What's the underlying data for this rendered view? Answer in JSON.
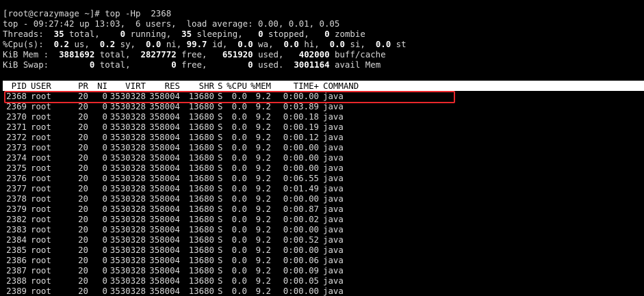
{
  "prompt": {
    "text": "[root@crazymage ~]# top -Hp  2368"
  },
  "summary": {
    "uptime_line": "top - 09:27:42 up 13:03,  6 users,  load average: 0.00, 0.01, 0.05",
    "threads": {
      "label": "Threads:",
      "total": "35",
      "total_label": "total,",
      "running": "0",
      "running_label": "running,",
      "sleeping": "35",
      "sleeping_label": "sleeping,",
      "stopped": "0",
      "stopped_label": "stopped,",
      "zombie": "0",
      "zombie_label": "zombie"
    },
    "cpu": {
      "label": "%Cpu(s):",
      "us": "0.2",
      "us_label": "us,",
      "sy": "0.2",
      "sy_label": "sy,",
      "ni": "0.0",
      "ni_label": "ni,",
      "id": "99.7",
      "id_label": "id,",
      "wa": "0.0",
      "wa_label": "wa,",
      "hi": "0.0",
      "hi_label": "hi,",
      "si": "0.0",
      "si_label": "si,",
      "st": "0.0",
      "st_label": "st"
    },
    "mem": {
      "label": "KiB Mem :",
      "total": "3881692",
      "total_label": "total,",
      "free": "2827772",
      "free_label": "free,",
      "used": "651920",
      "used_label": "used,",
      "buff": "402000",
      "buff_label": "buff/cache"
    },
    "swap": {
      "label": "KiB Swap:",
      "total": "0",
      "total_label": "total,",
      "free": "0",
      "free_label": "free,",
      "used": "0",
      "used_label": "used.",
      "avail": "3001164",
      "avail_label": "avail Mem"
    }
  },
  "table": {
    "headers": {
      "pid": "PID",
      "user": "USER",
      "pr": "PR",
      "ni": "NI",
      "virt": "VIRT",
      "res": "RES",
      "shr": "SHR",
      "s": "S",
      "cpu": "%CPU",
      "mem": "%MEM",
      "time": "TIME+",
      "command": "COMMAND"
    },
    "rows": [
      {
        "pid": "2368",
        "user": "root",
        "pr": "20",
        "ni": "0",
        "virt": "3530328",
        "res": "358004",
        "shr": "13680",
        "s": "S",
        "cpu": "0.0",
        "mem": "9.2",
        "time": "0:00.00",
        "command": "java"
      },
      {
        "pid": "2369",
        "user": "root",
        "pr": "20",
        "ni": "0",
        "virt": "3530328",
        "res": "358004",
        "shr": "13680",
        "s": "S",
        "cpu": "0.0",
        "mem": "9.2",
        "time": "0:03.89",
        "command": "java"
      },
      {
        "pid": "2370",
        "user": "root",
        "pr": "20",
        "ni": "0",
        "virt": "3530328",
        "res": "358004",
        "shr": "13680",
        "s": "S",
        "cpu": "0.0",
        "mem": "9.2",
        "time": "0:00.18",
        "command": "java"
      },
      {
        "pid": "2371",
        "user": "root",
        "pr": "20",
        "ni": "0",
        "virt": "3530328",
        "res": "358004",
        "shr": "13680",
        "s": "S",
        "cpu": "0.0",
        "mem": "9.2",
        "time": "0:00.19",
        "command": "java"
      },
      {
        "pid": "2372",
        "user": "root",
        "pr": "20",
        "ni": "0",
        "virt": "3530328",
        "res": "358004",
        "shr": "13680",
        "s": "S",
        "cpu": "0.0",
        "mem": "9.2",
        "time": "0:00.12",
        "command": "java"
      },
      {
        "pid": "2373",
        "user": "root",
        "pr": "20",
        "ni": "0",
        "virt": "3530328",
        "res": "358004",
        "shr": "13680",
        "s": "S",
        "cpu": "0.0",
        "mem": "9.2",
        "time": "0:00.00",
        "command": "java"
      },
      {
        "pid": "2374",
        "user": "root",
        "pr": "20",
        "ni": "0",
        "virt": "3530328",
        "res": "358004",
        "shr": "13680",
        "s": "S",
        "cpu": "0.0",
        "mem": "9.2",
        "time": "0:00.00",
        "command": "java"
      },
      {
        "pid": "2375",
        "user": "root",
        "pr": "20",
        "ni": "0",
        "virt": "3530328",
        "res": "358004",
        "shr": "13680",
        "s": "S",
        "cpu": "0.0",
        "mem": "9.2",
        "time": "0:00.00",
        "command": "java"
      },
      {
        "pid": "2376",
        "user": "root",
        "pr": "20",
        "ni": "0",
        "virt": "3530328",
        "res": "358004",
        "shr": "13680",
        "s": "S",
        "cpu": "0.0",
        "mem": "9.2",
        "time": "0:06.55",
        "command": "java"
      },
      {
        "pid": "2377",
        "user": "root",
        "pr": "20",
        "ni": "0",
        "virt": "3530328",
        "res": "358004",
        "shr": "13680",
        "s": "S",
        "cpu": "0.0",
        "mem": "9.2",
        "time": "0:01.49",
        "command": "java"
      },
      {
        "pid": "2378",
        "user": "root",
        "pr": "20",
        "ni": "0",
        "virt": "3530328",
        "res": "358004",
        "shr": "13680",
        "s": "S",
        "cpu": "0.0",
        "mem": "9.2",
        "time": "0:00.00",
        "command": "java"
      },
      {
        "pid": "2379",
        "user": "root",
        "pr": "20",
        "ni": "0",
        "virt": "3530328",
        "res": "358004",
        "shr": "13680",
        "s": "S",
        "cpu": "0.0",
        "mem": "9.2",
        "time": "0:00.87",
        "command": "java"
      },
      {
        "pid": "2382",
        "user": "root",
        "pr": "20",
        "ni": "0",
        "virt": "3530328",
        "res": "358004",
        "shr": "13680",
        "s": "S",
        "cpu": "0.0",
        "mem": "9.2",
        "time": "0:00.02",
        "command": "java"
      },
      {
        "pid": "2383",
        "user": "root",
        "pr": "20",
        "ni": "0",
        "virt": "3530328",
        "res": "358004",
        "shr": "13680",
        "s": "S",
        "cpu": "0.0",
        "mem": "9.2",
        "time": "0:00.00",
        "command": "java"
      },
      {
        "pid": "2384",
        "user": "root",
        "pr": "20",
        "ni": "0",
        "virt": "3530328",
        "res": "358004",
        "shr": "13680",
        "s": "S",
        "cpu": "0.0",
        "mem": "9.2",
        "time": "0:00.52",
        "command": "java"
      },
      {
        "pid": "2385",
        "user": "root",
        "pr": "20",
        "ni": "0",
        "virt": "3530328",
        "res": "358004",
        "shr": "13680",
        "s": "S",
        "cpu": "0.0",
        "mem": "9.2",
        "time": "0:00.00",
        "command": "java"
      },
      {
        "pid": "2386",
        "user": "root",
        "pr": "20",
        "ni": "0",
        "virt": "3530328",
        "res": "358004",
        "shr": "13680",
        "s": "S",
        "cpu": "0.0",
        "mem": "9.2",
        "time": "0:00.06",
        "command": "java"
      },
      {
        "pid": "2387",
        "user": "root",
        "pr": "20",
        "ni": "0",
        "virt": "3530328",
        "res": "358004",
        "shr": "13680",
        "s": "S",
        "cpu": "0.0",
        "mem": "9.2",
        "time": "0:00.09",
        "command": "java"
      },
      {
        "pid": "2388",
        "user": "root",
        "pr": "20",
        "ni": "0",
        "virt": "3530328",
        "res": "358004",
        "shr": "13680",
        "s": "S",
        "cpu": "0.0",
        "mem": "9.2",
        "time": "0:00.05",
        "command": "java"
      },
      {
        "pid": "2389",
        "user": "root",
        "pr": "20",
        "ni": "0",
        "virt": "3530328",
        "res": "358004",
        "shr": "13680",
        "s": "S",
        "cpu": "0.0",
        "mem": "9.2",
        "time": "0:00.00",
        "command": "java"
      }
    ]
  },
  "colors": {
    "background": "#000000",
    "text": "#d8d8d8",
    "bold_text": "#ffffff",
    "header_bar": "#ffffff",
    "highlight_box": "#e8272b"
  }
}
